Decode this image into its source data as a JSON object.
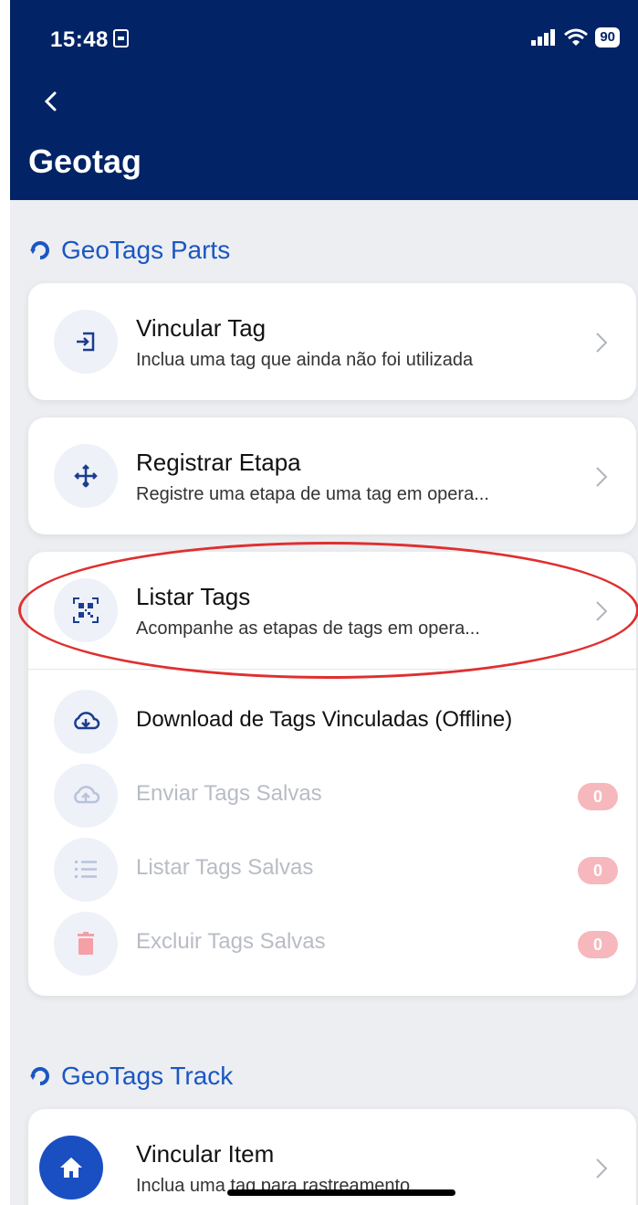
{
  "status_bar": {
    "time": "15:48",
    "battery": "90"
  },
  "header": {
    "title": "Geotag"
  },
  "section_parts": {
    "title": "GeoTags Parts"
  },
  "vincular_tag": {
    "title": "Vincular Tag",
    "subtitle": "Inclua uma tag que ainda não foi utilizada"
  },
  "registrar_etapa": {
    "title": "Registrar Etapa",
    "subtitle": "Registre uma etapa de uma tag em opera..."
  },
  "listar_tags": {
    "title": "Listar Tags",
    "subtitle": "Acompanhe as etapas de tags em opera..."
  },
  "download": {
    "label": "Download de Tags Vinculadas (Offline)"
  },
  "enviar": {
    "label": "Enviar Tags Salvas",
    "count": "0"
  },
  "listar_salvas": {
    "label": "Listar Tags Salvas",
    "count": "0"
  },
  "excluir": {
    "label": "Excluir Tags Salvas",
    "count": "0"
  },
  "section_track": {
    "title": "GeoTags Track"
  },
  "vincular_item": {
    "title": "Vincular Item",
    "subtitle": "Inclua uma tag para rastreamento"
  },
  "colors": {
    "header": "#022466",
    "accent": "#1a56c4",
    "badge": "#f6b8bc",
    "highlight": "#e02f2f"
  },
  "icons": [
    "back-chevron-icon",
    "sync-icon",
    "login-icon",
    "move-icon",
    "qr-code-icon",
    "cloud-download-icon",
    "cloud-upload-icon",
    "list-icon",
    "trash-icon",
    "home-icon",
    "chevron-right-icon"
  ]
}
